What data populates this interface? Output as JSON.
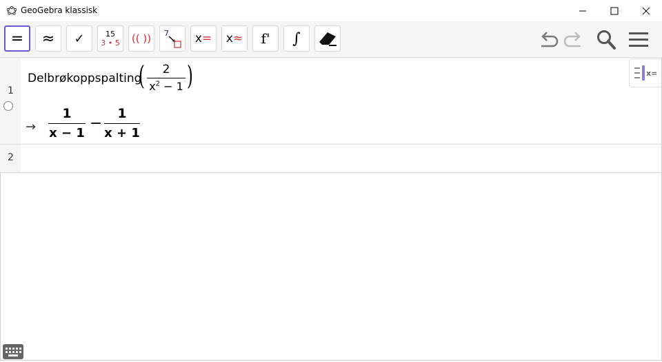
{
  "window": {
    "title": "GeoGebra klassisk",
    "controls": {
      "minimize": "minimize-icon",
      "maximize": "maximize-icon",
      "close": "close-icon"
    }
  },
  "toolbar": {
    "tools": [
      {
        "name": "evaluate",
        "label": "=",
        "selected": true
      },
      {
        "name": "numeric",
        "label": "≈"
      },
      {
        "name": "keep-input",
        "label": "✓"
      },
      {
        "name": "factor",
        "top": "15",
        "bottom": "3 • 5"
      },
      {
        "name": "expand",
        "label": "(( ))"
      },
      {
        "name": "substitute",
        "label": "7"
      },
      {
        "name": "solve",
        "label": "x="
      },
      {
        "name": "solve-numerically",
        "label": "x≈"
      },
      {
        "name": "derivative",
        "label": "f'"
      },
      {
        "name": "integral",
        "label": "∫"
      },
      {
        "name": "delete",
        "label": "eraser-icon"
      }
    ],
    "right": [
      "undo-icon",
      "redo-icon",
      "search-icon",
      "menu-icon"
    ]
  },
  "algebra": {
    "rows": [
      {
        "number": "1",
        "command": "Delbrøkoppspalting",
        "input_fraction": {
          "numerator": "2",
          "denominator_base": "x",
          "denominator_exp": "2",
          "denominator_rest": " − 1"
        },
        "output": {
          "arrow": "→",
          "term1": {
            "numerator": "1",
            "denominator": "x − 1"
          },
          "operator": "−",
          "term2": {
            "numerator": "1",
            "denominator": "x + 1"
          }
        }
      },
      {
        "number": "2"
      }
    ]
  },
  "colors": {
    "accent": "#6557d2",
    "red": "#d32f2f",
    "gutter": "#f5f5f5"
  }
}
